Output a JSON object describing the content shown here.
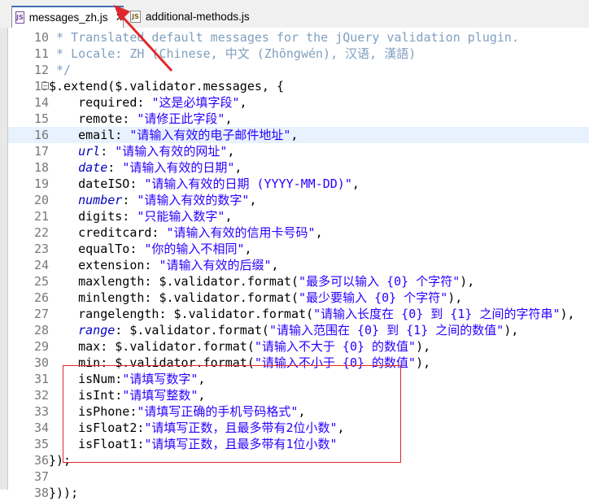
{
  "tabs": [
    {
      "label": "messages_zh.js",
      "active": true
    },
    {
      "label": "additional-methods.js",
      "active": false
    }
  ],
  "editor": {
    "lines": [
      {
        "num": "10",
        "text": " * Translated default messages for the jQuery validation plugin.",
        "cls": "cm"
      },
      {
        "num": "11",
        "text": " * Locale: ZH (Chinese, 中文 (Zhōngwén), 汉语, 漢語)",
        "cls": "cm"
      },
      {
        "num": "12",
        "text": " */",
        "cls": "cm"
      },
      {
        "num": "13",
        "text": "$.extend($.validator.messages, {",
        "fold": true
      },
      {
        "num": "14",
        "text": "    required: \"这是必填字段\","
      },
      {
        "num": "15",
        "text": "    remote: \"请修正此字段\","
      },
      {
        "num": "16",
        "text": "    email: \"请输入有效的电子邮件地址\",",
        "hl": true
      },
      {
        "num": "17",
        "text": "    url: \"请输入有效的网址\","
      },
      {
        "num": "18",
        "text": "    date: \"请输入有效的日期\","
      },
      {
        "num": "19",
        "text": "    dateISO: \"请输入有效的日期 (YYYY-MM-DD)\","
      },
      {
        "num": "20",
        "text": "    number: \"请输入有效的数字\","
      },
      {
        "num": "21",
        "text": "    digits: \"只能输入数字\","
      },
      {
        "num": "22",
        "text": "    creditcard: \"请输入有效的信用卡号码\","
      },
      {
        "num": "23",
        "text": "    equalTo: \"你的输入不相同\","
      },
      {
        "num": "24",
        "text": "    extension: \"请输入有效的后缀\","
      },
      {
        "num": "25",
        "text": "    maxlength: $.validator.format(\"最多可以输入 {0} 个字符\"),"
      },
      {
        "num": "26",
        "text": "    minlength: $.validator.format(\"最少要输入 {0} 个字符\"),"
      },
      {
        "num": "27",
        "text": "    rangelength: $.validator.format(\"请输入长度在 {0} 到 {1} 之间的字符串\"),"
      },
      {
        "num": "28",
        "text": "    range: $.validator.format(\"请输入范围在 {0} 到 {1} 之间的数值\"),"
      },
      {
        "num": "29",
        "text": "    max: $.validator.format(\"请输入不大于 {0} 的数值\"),"
      },
      {
        "num": "30",
        "text": "    min: $.validator.format(\"请输入不小于 {0} 的数值\"),"
      },
      {
        "num": "31",
        "text": "    isNum:\"请填写数字\","
      },
      {
        "num": "32",
        "text": "    isInt:\"请填写整数\","
      },
      {
        "num": "33",
        "text": "    isPhone:\"请填写正确的手机号码格式\","
      },
      {
        "num": "34",
        "text": "    isFloat2:\"请填写正数，且最多带有2位小数\","
      },
      {
        "num": "35",
        "text": "    isFloat1:\"请填写正数，且最多带有1位小数\""
      },
      {
        "num": "36",
        "text": "});"
      },
      {
        "num": "37",
        "text": ""
      },
      {
        "num": "38",
        "text": "}));"
      }
    ]
  },
  "colors": {
    "highlight_box": "#e0282c",
    "arrow": "#e0282c",
    "current_line": "#e8f2fe"
  }
}
